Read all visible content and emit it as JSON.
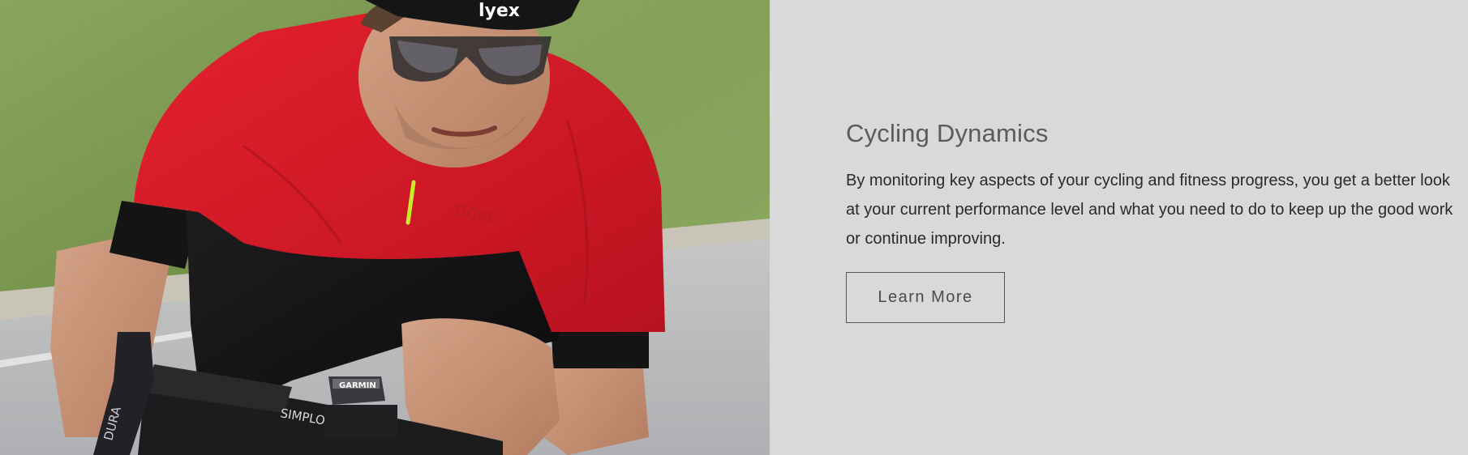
{
  "hero": {
    "image_label": "cyclist-photo",
    "brand_marks": {
      "helmet": "lyex",
      "computer": "GARMIN",
      "handlebar": "SIMPLON",
      "lever": "DURA",
      "jersey": "GORE"
    }
  },
  "feature": {
    "title": "Cycling Dynamics",
    "description": "By monitoring key aspects of your cycling and fitness progress, you get a better look at your current performance level and what you need to do to keep up the good work or continue improving.",
    "cta_label": "Learn More"
  },
  "colors": {
    "panel_bg": "#d9d9d9",
    "title": "#5b5b5b",
    "body_text": "#2a2a2a",
    "button_border": "#555555",
    "jersey_red": "#d81f2a"
  }
}
